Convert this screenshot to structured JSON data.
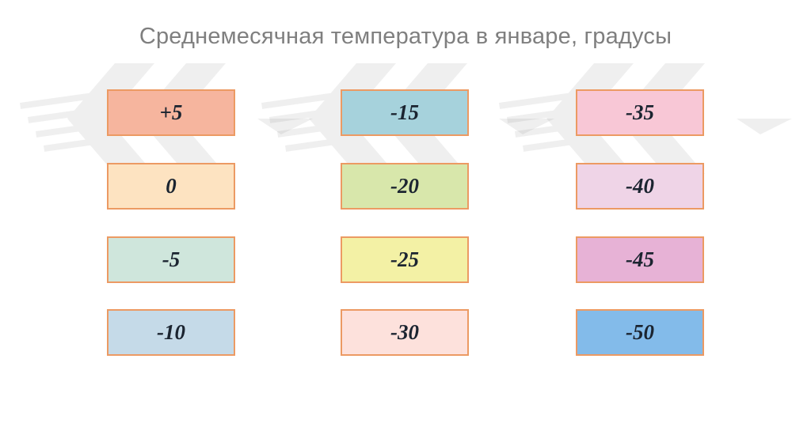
{
  "title": "Среднемесячная температура в январе, градусы",
  "legend": [
    {
      "label": "+5",
      "color": "#f6b59e"
    },
    {
      "label": "0",
      "color": "#fde3c1"
    },
    {
      "label": "-5",
      "color": "#cfe6dc"
    },
    {
      "label": "-10",
      "color": "#c5dae8"
    },
    {
      "label": "-15",
      "color": "#a6d2dc"
    },
    {
      "label": "-20",
      "color": "#d8e7ab"
    },
    {
      "label": "-25",
      "color": "#f3f1a5"
    },
    {
      "label": "-30",
      "color": "#fde1dc"
    },
    {
      "label": "-35",
      "color": "#f8c7d6"
    },
    {
      "label": "-40",
      "color": "#efd4e7"
    },
    {
      "label": "-45",
      "color": "#e7b2d6"
    },
    {
      "label": "-50",
      "color": "#83bbea"
    }
  ]
}
